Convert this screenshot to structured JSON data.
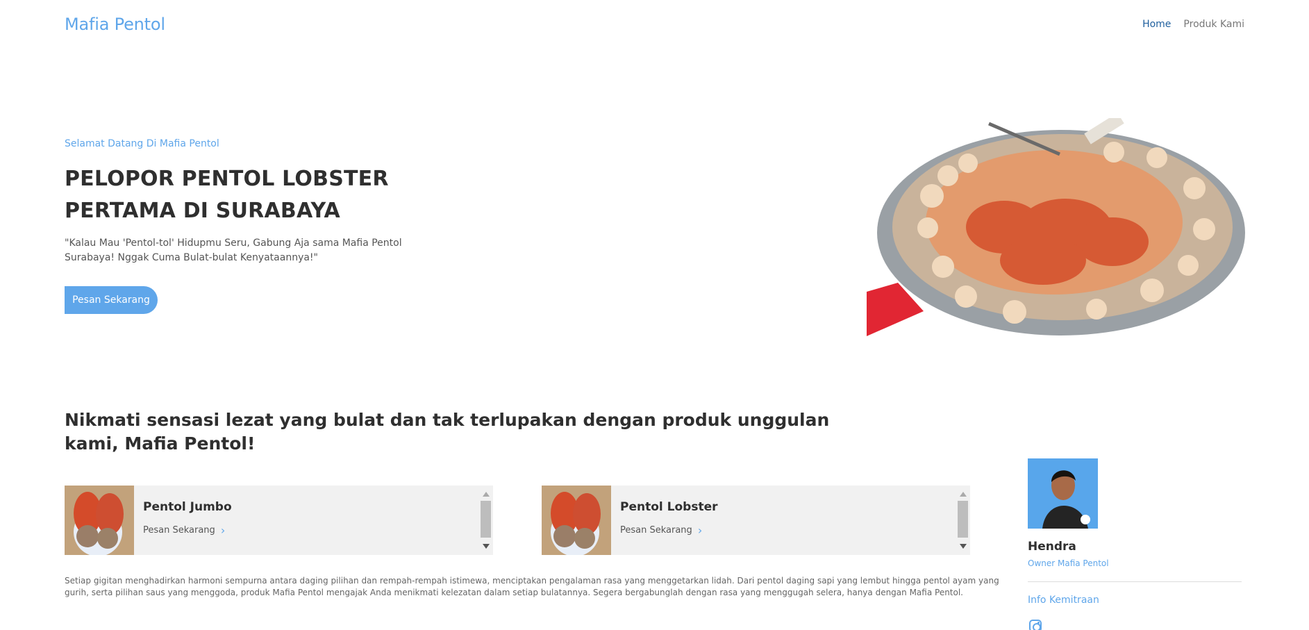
{
  "navbar": {
    "brand": "Mafia Pentol",
    "items": [
      {
        "label": "Home",
        "active": true
      },
      {
        "label": "Produk Kami",
        "active": false
      }
    ]
  },
  "hero": {
    "subtitle": "Selamat Datang Di Mafia Pentol",
    "title": "PELOPOR PENTOL LOBSTER PERTAMA DI SURABAYA",
    "quote": "\"Kalau Mau 'Pentol-tol' Hidupmu Seru, Gabung Aja sama Mafia Pentol Surabaya! Nggak Cuma Bulat-bulat Kenyataannya!\"",
    "cta": "Pesan Sekarang"
  },
  "section": {
    "title": "Nikmati sensasi lezat yang bulat dan tak terlupakan dengan produk unggulan kami, Mafia Pentol!",
    "products": [
      {
        "name": "Pentol Jumbo",
        "action": "Pesan Sekarang"
      },
      {
        "name": "Pentol Lobster",
        "action": "Pesan Sekarang"
      }
    ],
    "description": "Setiap gigitan menghadirkan harmoni sempurna antara daging pilihan dan rempah-rempah istimewa, menciptakan pengalaman rasa yang menggetarkan lidah. Dari pentol daging sapi yang lembut hingga pentol ayam yang gurih, serta pilihan saus yang menggoda, produk Mafia Pentol mengajak Anda menikmati kelezatan dalam setiap bulatannya. Segera bergabunglah dengan rasa yang menggugah selera, hanya dengan Mafia Pentol."
  },
  "owner": {
    "name": "Hendra",
    "role": "Owner Mafia Pentol",
    "link": "Info Kemitraan"
  },
  "icons": {
    "chevron": "chevron-right-icon",
    "instagram": "instagram-icon"
  },
  "colors": {
    "accent": "#5fa6ea",
    "active_nav": "#1f5f9e",
    "text": "#2f2f2f",
    "card": "#f1f1f1"
  }
}
